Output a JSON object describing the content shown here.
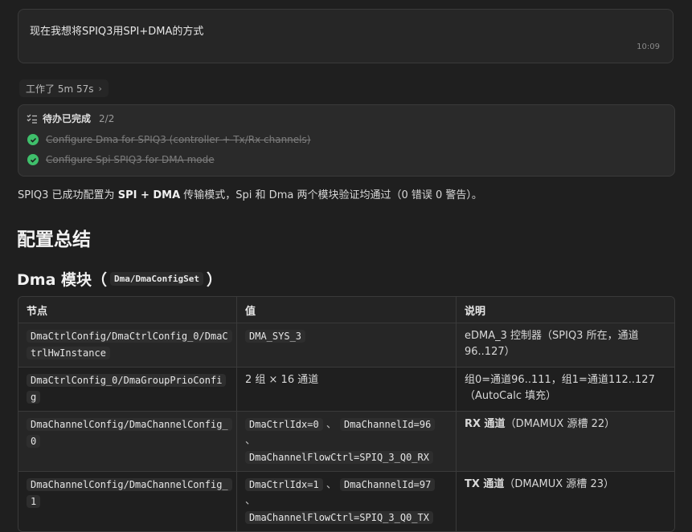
{
  "user_message": {
    "text": "现在我想将SPIQ3用SPI+DMA的方式",
    "time": "10:09"
  },
  "worked": {
    "label": "工作了 5m 57s",
    "chevron": "›"
  },
  "todo": {
    "title": "待办已完成",
    "count": "2/2",
    "items": [
      {
        "label": "Configure Dma for SPIQ3 (controller + Tx/Rx channels)"
      },
      {
        "label": "Configure Spi SPIQ3 for DMA mode"
      }
    ]
  },
  "summary": {
    "prefix": "SPIQ3 已成功配置为 ",
    "bold": "SPI + DMA",
    "suffix": " 传输模式，Spi 和 Dma 两个模块验证均通过（0 错误 0 警告）。"
  },
  "heading1": "配置总结",
  "heading2": {
    "prefix": "Dma 模块（",
    "code": "Dma/DmaConfigSet",
    "suffix": "）"
  },
  "table": {
    "headers": [
      "节点",
      "值",
      "说明"
    ],
    "rows": [
      {
        "node": "DmaCtrlConfig/DmaCtrlConfig_0/DmaCtrlHwInstance",
        "value": [
          "DMA_SYS_3"
        ],
        "desc_bold": "",
        "desc": "eDMA_3 控制器（SPIQ3 所在，通道 96..127）"
      },
      {
        "node": "DmaCtrlConfig_0/DmaGroupPrioConfig",
        "value_text": "2 组 × 16 通道",
        "desc_bold": "",
        "desc": "组0=通道96..111，组1=通道112..127（AutoCalc 填充）"
      },
      {
        "node": "DmaChannelConfig/DmaChannelConfig_0",
        "value": [
          "DmaCtrlIdx=0",
          "DmaChannelId=96",
          "DmaChannelFlowCtrl=SPIQ_3_Q0_RX"
        ],
        "desc_bold": "RX 通道",
        "desc": "（DMAMUX 源槽 22）"
      },
      {
        "node": "DmaChannelConfig/DmaChannelConfig_1",
        "value": [
          "DmaCtrlIdx=1",
          "DmaChannelId=97",
          "DmaChannelFlowCtrl=SPIQ_3_Q0_TX"
        ],
        "desc_bold": "TX 通道",
        "desc": "（DMAMUX 源槽 23）"
      }
    ]
  },
  "colors": {
    "background": "#1f1f1f",
    "check": "#3fbf6b"
  },
  "icons": {
    "todo": "checklist-icon",
    "item": "check-circle-icon"
  }
}
